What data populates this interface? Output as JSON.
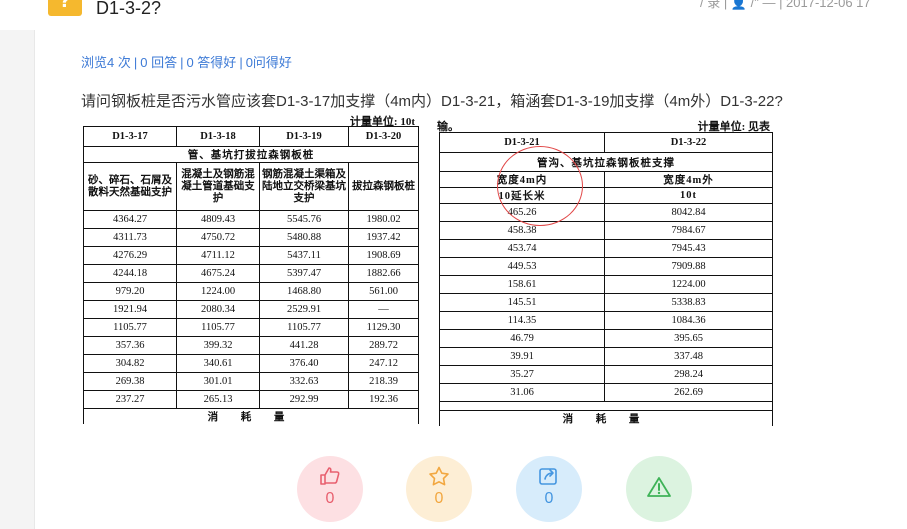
{
  "header": {
    "badge": "?",
    "title": "D1-3-2?",
    "meta": "/ 录 | 👤 /\" —  | 2017-12-06 17"
  },
  "stats": {
    "views": "浏览4 次",
    "answers": "0 回答",
    "good_answers": "0 答得好",
    "good_questions": "0问得好"
  },
  "question": "请问钢板桩是否污水管应该套D1-3-17加支撑（4m内）D1-3-21，箱涵套D1-3-19加支撑（4m外）D1-3-22?",
  "left_table": {
    "unit": "计量单位: 10t",
    "codes": [
      "D1-3-17",
      "D1-3-18",
      "D1-3-19",
      "D1-3-20"
    ],
    "group_title": "管、基坑打拔拉森钢板桩",
    "descriptions": [
      "砂、碎石、石屑及散料天然基础支护",
      "混凝土及钢筋混凝土管道基础支护",
      "钢筋混凝土渠箱及陆地立交桥梁基坑支护",
      "拔拉森钢板桩"
    ],
    "group1": [
      [
        "4364.27",
        "4809.43",
        "5545.76",
        "1980.02"
      ],
      [
        "4311.73",
        "4750.72",
        "5480.88",
        "1937.42"
      ],
      [
        "4276.29",
        "4711.12",
        "5437.11",
        "1908.69"
      ],
      [
        "4244.18",
        "4675.24",
        "5397.47",
        "1882.66"
      ]
    ],
    "group2": [
      [
        "979.20",
        "1224.00",
        "1468.80",
        "561.00"
      ],
      [
        "1921.94",
        "2080.34",
        "2529.91",
        "—"
      ],
      [
        "1105.77",
        "1105.77",
        "1105.77",
        "1129.30"
      ]
    ],
    "group3": [
      [
        "357.36",
        "399.32",
        "441.28",
        "289.72"
      ],
      [
        "304.82",
        "340.61",
        "376.40",
        "247.12"
      ],
      [
        "269.38",
        "301.01",
        "332.63",
        "218.39"
      ],
      [
        "237.27",
        "265.13",
        "292.99",
        "192.36"
      ]
    ],
    "footer": "消 耗 量"
  },
  "right_table": {
    "pre": "输。",
    "unit": "计量单位: 见表",
    "codes": [
      "D1-3-21",
      "D1-3-22"
    ],
    "group_title": "管沟、基坑拉森钢板桩支撑",
    "widths": [
      "宽度4m内",
      "宽度4m外"
    ],
    "units": [
      "10延长米",
      "10t"
    ],
    "group1": [
      [
        "465.26",
        "8042.84"
      ],
      [
        "458.38",
        "7984.67"
      ],
      [
        "453.74",
        "7945.43"
      ],
      [
        "449.53",
        "7909.88"
      ]
    ],
    "group2": [
      [
        "158.61",
        "1224.00"
      ],
      [
        "145.51",
        "5338.83"
      ],
      [
        "114.35",
        "1084.36"
      ]
    ],
    "group3": [
      [
        "46.79",
        "395.65"
      ],
      [
        "39.91",
        "337.48"
      ],
      [
        "35.27",
        "298.24"
      ],
      [
        "31.06",
        "262.69"
      ]
    ],
    "footer": "消 耗 量"
  },
  "actions": [
    {
      "name": "like",
      "icon": "thumbs-up-icon",
      "count": "0",
      "bg": "#fde0e3",
      "color": "#e8606f"
    },
    {
      "name": "favorite",
      "icon": "star-icon",
      "count": "0",
      "bg": "#fdeed5",
      "color": "#f2a740"
    },
    {
      "name": "share",
      "icon": "share-icon",
      "count": "0",
      "bg": "#d7ecfb",
      "color": "#4596e0"
    },
    {
      "name": "report",
      "icon": "warning-icon",
      "count": "",
      "bg": "#dcf3e0",
      "color": "#3fb358"
    }
  ]
}
